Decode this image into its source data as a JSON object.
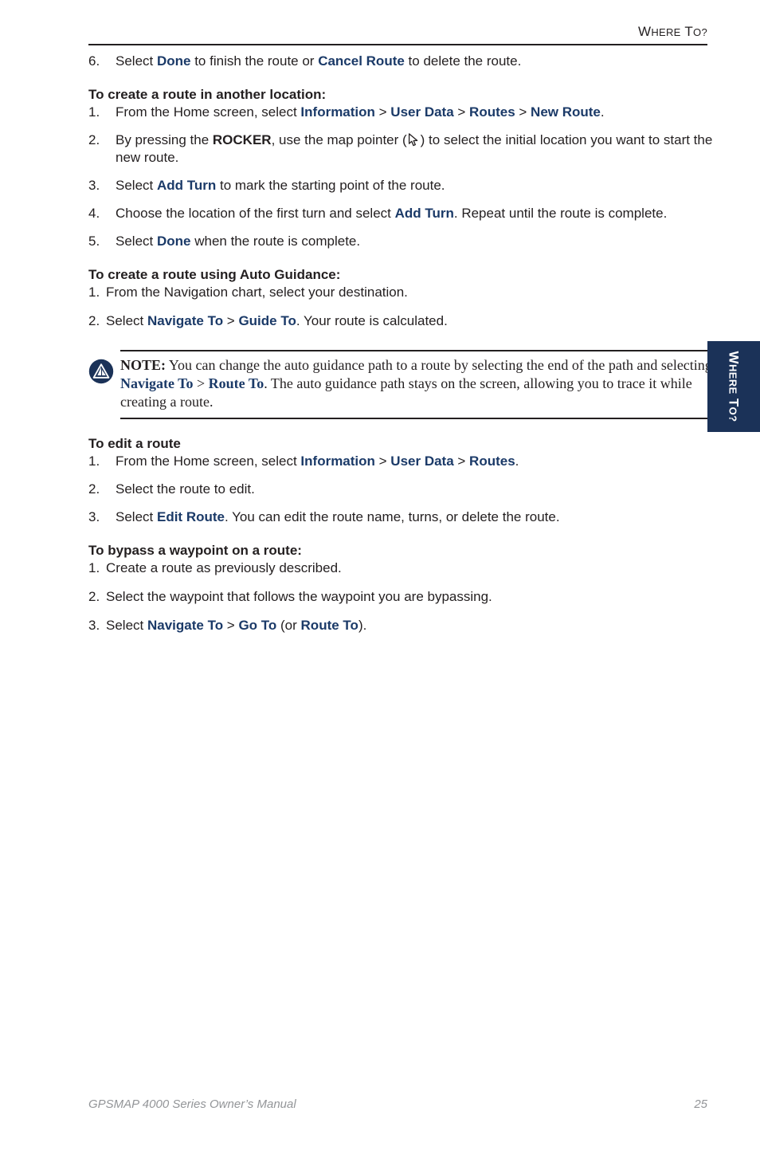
{
  "header": {
    "title_cap1": "W",
    "title_sc1": "HERE",
    "title_cap2": " T",
    "title_sc2": "O?"
  },
  "tab": {
    "cap1": "W",
    "sc1": "HERE",
    "cap2": " T",
    "sc2": "O?"
  },
  "colors": {
    "term_navy": "#1b3a68",
    "tab_navy": "#1b3258",
    "body_black": "#231f20",
    "footer_gray": "#939598"
  },
  "sections": {
    "carryover_step": {
      "num": "6.",
      "p1": "Select ",
      "term1": "Done",
      "p2": " to finish the route or ",
      "term2": "Cancel Route",
      "p3": " to delete the route."
    },
    "another_location": {
      "heading": "To create a route in another location:",
      "steps": [
        {
          "num": "1.",
          "p1": "From the Home screen, select ",
          "term1": "Information",
          "sep1": " > ",
          "term2": "User Data",
          "sep2": " > ",
          "term3": "Routes",
          "sep3": " > ",
          "term4": "New Route",
          "p2": "."
        },
        {
          "num": "2.",
          "p1": "By pressing the ",
          "term1": "ROCKER",
          "p2": ", use the map pointer (",
          "icon": "map-pointer-cursor-icon",
          "p3": ") to select the initial location you want to start the new route."
        },
        {
          "num": "3.",
          "p1": "Select ",
          "term1": "Add Turn",
          "p2": " to mark the starting point of the route."
        },
        {
          "num": "4.",
          "p1": "Choose the location of the first turn and select ",
          "term1": "Add Turn",
          "p2": ". Repeat until the route is complete."
        },
        {
          "num": "5.",
          "p1": "Select ",
          "term1": "Done",
          "p2": " when the route is complete."
        }
      ]
    },
    "auto_guidance": {
      "heading": "To create a route using Auto Guidance:",
      "steps": [
        {
          "num": "1.",
          "p1": "From the Navigation chart, select your destination."
        },
        {
          "num": "2.",
          "p1": "Select ",
          "term1": "Navigate To",
          "sep1": " > ",
          "term2": "Guide To",
          "p2": ". Your route is calculated."
        }
      ]
    },
    "note": {
      "icon": "garmin-triangle-icon",
      "label": "NOTE:",
      "p1": " You can change the auto guidance path to a route by selecting the end of the path and selecting ",
      "term1": "Navigate To",
      "sep1": " > ",
      "term2": "Route To",
      "p2": ". The auto guidance path stays on the screen, allowing you to trace it while creating a route."
    },
    "edit_route": {
      "heading": " To edit a route",
      "steps": [
        {
          "num": "1.",
          "p1": "From the Home screen, select ",
          "term1": "Information",
          "sep1": " > ",
          "term2": "User Data",
          "sep2": " > ",
          "term3": "Routes",
          "p2": "."
        },
        {
          "num": "2.",
          "p1": "Select the route to edit."
        },
        {
          "num": "3.",
          "p1": "Select ",
          "term1": "Edit Route",
          "p2": ". You can edit the route name, turns, or delete the route."
        }
      ]
    },
    "bypass_waypoint": {
      "heading": "To bypass a waypoint on a route:",
      "steps": [
        {
          "num": "1.",
          "p1": "Create a route as previously described."
        },
        {
          "num": "2.",
          "p1": "Select the waypoint that follows the waypoint you are bypassing."
        },
        {
          "num": "3.",
          "p1": "Select ",
          "term1": "Navigate To",
          "sep1": " > ",
          "term2": "Go To",
          "p2": " (or ",
          "term3": "Route To",
          "p3": ")."
        }
      ]
    }
  },
  "footer": {
    "manual": "GPSMAP 4000 Series Owner’s Manual",
    "page_number": "25"
  }
}
